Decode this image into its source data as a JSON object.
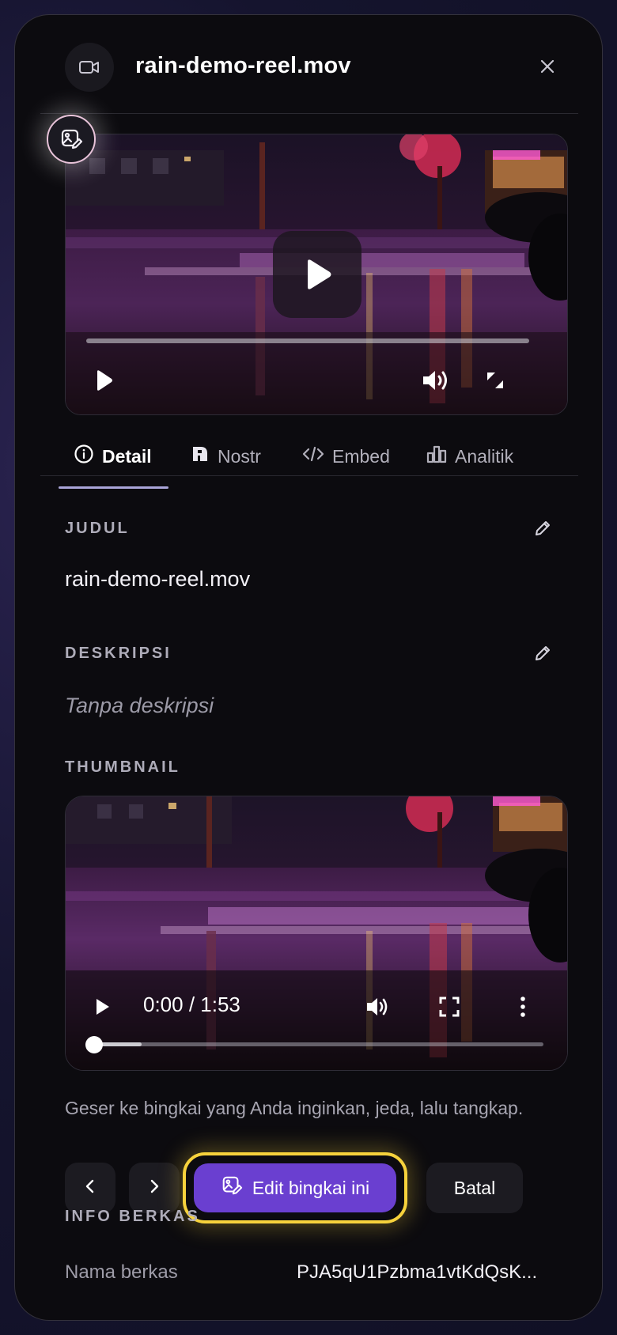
{
  "header": {
    "title": "rain-demo-reel.mov"
  },
  "player": {
    "progress_fraction": 0
  },
  "tabs": [
    {
      "label": "Detail",
      "active": true
    },
    {
      "label": "Nostr",
      "active": false
    },
    {
      "label": "Embed",
      "active": false
    },
    {
      "label": "Analitik",
      "active": false
    }
  ],
  "details": {
    "title_label": "JUDUL",
    "title_value": "rain-demo-reel.mov",
    "description_label": "DESKRIPSI",
    "description_value": "Tanpa deskripsi",
    "thumbnail_label": "THUMBNAIL"
  },
  "thumbnail_player": {
    "time": "0:00 / 1:53",
    "progress_fraction": 0
  },
  "thumbnail_hint": "Geser ke bingkai yang Anda inginkan, jeda, lalu tangkap.",
  "actions": {
    "edit_frame_label": "Edit bingkai ini",
    "cancel_label": "Batal"
  },
  "file_info": {
    "section_label": "INFO BERKAS",
    "name_label": "Nama berkas",
    "name_value": "PJA5qU1Pzbma1vtKdQsK..."
  },
  "colors": {
    "accent": "#6a3fd0",
    "focus_ring": "#f6d23c",
    "tab_indicator": "#a9a4d8",
    "panel_bg": "#0c0b0f"
  },
  "icons": {
    "header": "video-camera-icon",
    "close": "close-icon",
    "thumbnail_edit": "image-edit-icon",
    "tab_detail": "info-circle-icon",
    "tab_nostr": "nostr-icon",
    "tab_embed": "code-icon",
    "tab_analitik": "bar-chart-icon"
  }
}
